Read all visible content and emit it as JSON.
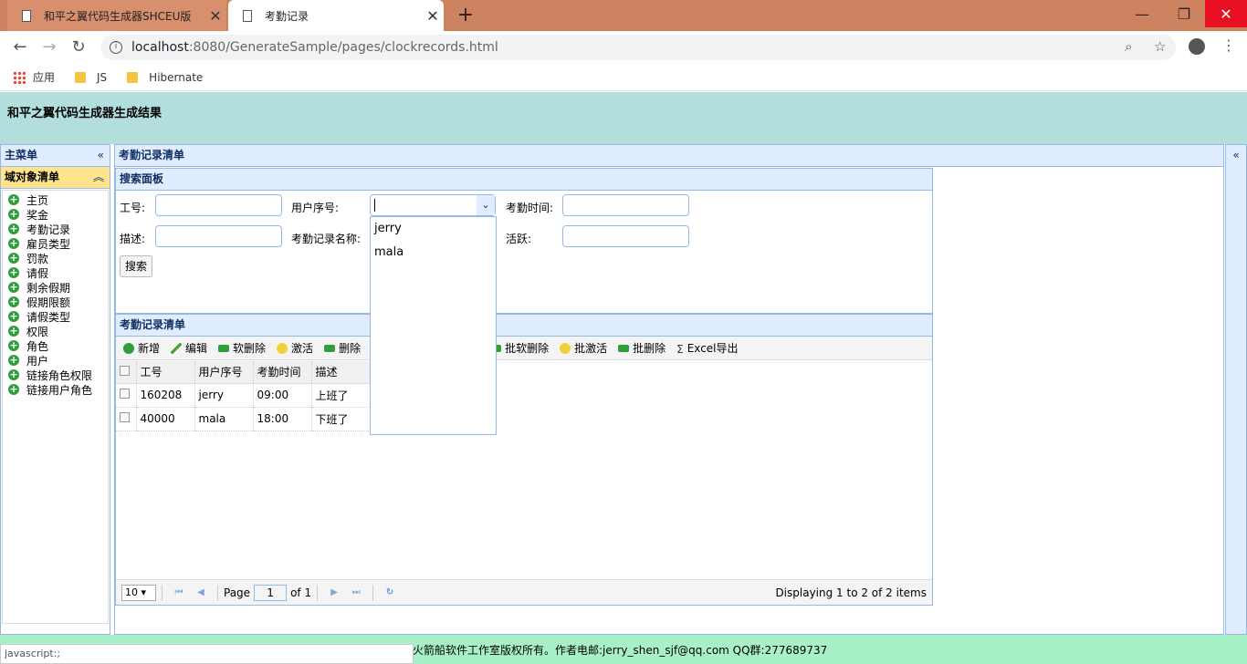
{
  "browser": {
    "tabs": [
      {
        "title": "和平之翼代码生成器SHCEU版"
      },
      {
        "title": "考勤记录"
      }
    ],
    "url_host": "localhost",
    "url_path": ":8080/GenerateSample/pages/clockrecords.html",
    "bookmarks": [
      {
        "label": "应用"
      },
      {
        "label": "JS"
      },
      {
        "label": "Hibernate"
      }
    ]
  },
  "header": {
    "title": "和平之翼代码生成器生成结果"
  },
  "west": {
    "title": "主菜单",
    "accordion_title": "域对象清单",
    "items": [
      {
        "label": "主页"
      },
      {
        "label": "奖金"
      },
      {
        "label": "考勤记录"
      },
      {
        "label": "雇员类型"
      },
      {
        "label": "罚款"
      },
      {
        "label": "请假"
      },
      {
        "label": "剩余假期"
      },
      {
        "label": "假期限额"
      },
      {
        "label": "请假类型"
      },
      {
        "label": "权限"
      },
      {
        "label": "角色"
      },
      {
        "label": "用户"
      },
      {
        "label": "链接角色权限"
      },
      {
        "label": "链接用户角色"
      }
    ]
  },
  "center": {
    "title": "考勤记录清单",
    "search": {
      "title": "搜索面板",
      "labels": {
        "empid": "工号:",
        "userid": "用户序号:",
        "time": "考勤时间:",
        "desc": "描述:",
        "name": "考勤记录名称:",
        "active": "活跃:"
      },
      "search_button": "搜索",
      "combo_options": [
        {
          "label": "jerry"
        },
        {
          "label": "mala"
        }
      ]
    },
    "grid": {
      "title": "考勤记录清单",
      "toolbar": [
        {
          "label": "新增",
          "icon": "add-icon"
        },
        {
          "label": "编辑",
          "icon": "edit-icon"
        },
        {
          "label": "软删除",
          "icon": "soft-delete-icon"
        },
        {
          "label": "激活",
          "icon": "activate-icon"
        },
        {
          "label": "删除",
          "icon": "delete-icon"
        },
        {
          "label": "批软删除",
          "icon": "batch-soft-delete-icon"
        },
        {
          "label": "批激活",
          "icon": "batch-activate-icon"
        },
        {
          "label": "批删除",
          "icon": "batch-delete-icon"
        },
        {
          "label": "Excel导出",
          "icon": "sigma-icon"
        }
      ],
      "columns": [
        "工号",
        "用户序号",
        "考勤时间",
        "描述"
      ],
      "rows": [
        {
          "empid": "160208",
          "user": "jerry",
          "time": "09:00",
          "desc": "上班了"
        },
        {
          "empid": "40000",
          "user": "mala",
          "time": "18:00",
          "desc": "下班了"
        }
      ],
      "pager": {
        "page_size": "10",
        "page_label": "Page",
        "page_value": "1",
        "of_label": "of 1",
        "info": "Displaying 1 to 2 of 2 items"
      }
    }
  },
  "footer": {
    "text": "火箭船软件工作室版权所有。作者电邮:jerry_shen_sjf@qq.com QQ群:277689737"
  },
  "status_bar": {
    "text": "javascript:;"
  }
}
